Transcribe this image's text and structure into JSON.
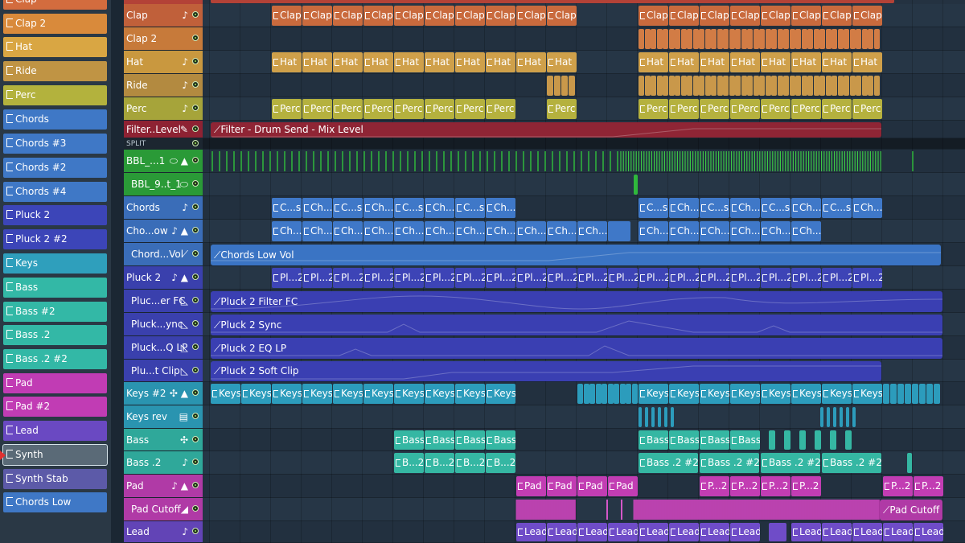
{
  "browser": {
    "items": [
      {
        "label": "Clap",
        "color": "#d36c3e"
      },
      {
        "label": "Clap 2",
        "color": "#d98a3b"
      },
      {
        "label": "Hat",
        "color": "#d9a643"
      },
      {
        "label": "Ride",
        "color": "#c09444"
      },
      {
        "label": "Perc",
        "color": "#b3b23d"
      },
      {
        "label": "Chords",
        "color": "#3f78c6"
      },
      {
        "label": "Chords #3",
        "color": "#3f78c6"
      },
      {
        "label": "Chords #2",
        "color": "#3f78c6"
      },
      {
        "label": "Chords #4",
        "color": "#3f78c6"
      },
      {
        "label": "Pluck 2",
        "color": "#3c45b8"
      },
      {
        "label": "Pluck 2 #2",
        "color": "#3c45b8"
      },
      {
        "label": "Keys",
        "color": "#2f9fbc"
      },
      {
        "label": "Bass",
        "color": "#33b8a6"
      },
      {
        "label": "Bass #2",
        "color": "#33b8a6"
      },
      {
        "label": "Bass .2",
        "color": "#33b8a6"
      },
      {
        "label": "Bass .2 #2",
        "color": "#33b8a6"
      },
      {
        "label": "Pad",
        "color": "#c13cb4"
      },
      {
        "label": "Pad #2",
        "color": "#c13cb4"
      },
      {
        "label": "Lead",
        "color": "#6a49c2"
      },
      {
        "label": "Synth",
        "color": "#5a6a77"
      },
      {
        "label": "Synth Stab",
        "color": "#5c5aa8"
      },
      {
        "label": "Chords Low",
        "color": "#3f78c6"
      }
    ]
  },
  "tracks": [
    {
      "label": "Clap",
      "color": "#c0603a",
      "icon": "♪"
    },
    {
      "label": "Clap 2",
      "color": "#c77a3a",
      "icon": ""
    },
    {
      "label": "Hat",
      "color": "#c9983f",
      "icon": "♪"
    },
    {
      "label": "Ride",
      "color": "#b38a40",
      "icon": "♪"
    },
    {
      "label": "Perc",
      "color": "#a6a43a",
      "icon": "♪"
    },
    {
      "label": "Filter..Level",
      "color": "#8e2233",
      "icon": "✎"
    },
    {
      "label": "SPLIT",
      "color": "#1c2630",
      "icon": ""
    },
    {
      "label": "BBL_...1",
      "color": "#2a9a37",
      "icon": "⬭ ▲"
    },
    {
      "label": "BBL_9..t_1",
      "color": "#2a9a37",
      "icon": "⬭"
    },
    {
      "label": "Chords",
      "color": "#3a6db8",
      "icon": "♪"
    },
    {
      "label": "Cho...ow",
      "color": "#3a6db8",
      "icon": "♪ ▲"
    },
    {
      "label": "Chord...Vol",
      "color": "#3a6db8",
      "icon": "⟋"
    },
    {
      "label": "Pluck 2",
      "color": "#3a40ad",
      "icon": "♪ ▲"
    },
    {
      "label": "Pluc...er FC",
      "color": "#3a40ad",
      "icon": "◺"
    },
    {
      "label": "Pluck...ync",
      "color": "#3a40ad",
      "icon": "◺"
    },
    {
      "label": "Pluck...Q LP",
      "color": "#3a40ad",
      "icon": "◺"
    },
    {
      "label": "Plu...t Clip",
      "color": "#3a40ad",
      "icon": "◺"
    },
    {
      "label": "Keys #2",
      "color": "#2a94b0",
      "icon": "✣ ▲"
    },
    {
      "label": "Keys rev",
      "color": "#2a94b0",
      "icon": "▤"
    },
    {
      "label": "Bass",
      "color": "#2fa89a",
      "icon": "✣"
    },
    {
      "label": "Bass .2",
      "color": "#2fa89a",
      "icon": "♪"
    },
    {
      "label": "Pad",
      "color": "#b03aa6",
      "icon": "♪ ▲"
    },
    {
      "label": "Pad Cutoff",
      "color": "#b03aa6",
      "icon": "◢"
    },
    {
      "label": "Lead",
      "color": "#6244b6",
      "icon": "♪"
    }
  ],
  "clips": {
    "clap": "Clap",
    "hat": "Hat",
    "perc": "Perc",
    "chords_short": "C...s",
    "chords_short2": "Ch...s",
    "cho_low": "Ch...",
    "pluck": "Pl...2",
    "keys": "Keys",
    "bass": "Bass",
    "bass2_short": "B...2",
    "bass2_long": "Bass .2 #2",
    "pad": "Pad",
    "pad2": "P...2",
    "lead": "Lead"
  },
  "automation": {
    "filter": "Filter - Drum Send - Mix Level",
    "chords_vol": "Chords Low Vol",
    "pluck_fc": "Pluck 2 Filter FC",
    "pluck_sync": "Pluck 2 Sync",
    "pluck_lp": "Pluck 2 EQ LP",
    "pluck_clip": "Pluck 2 Soft Clip",
    "pad_cutoff": "Pad Cutoff"
  }
}
